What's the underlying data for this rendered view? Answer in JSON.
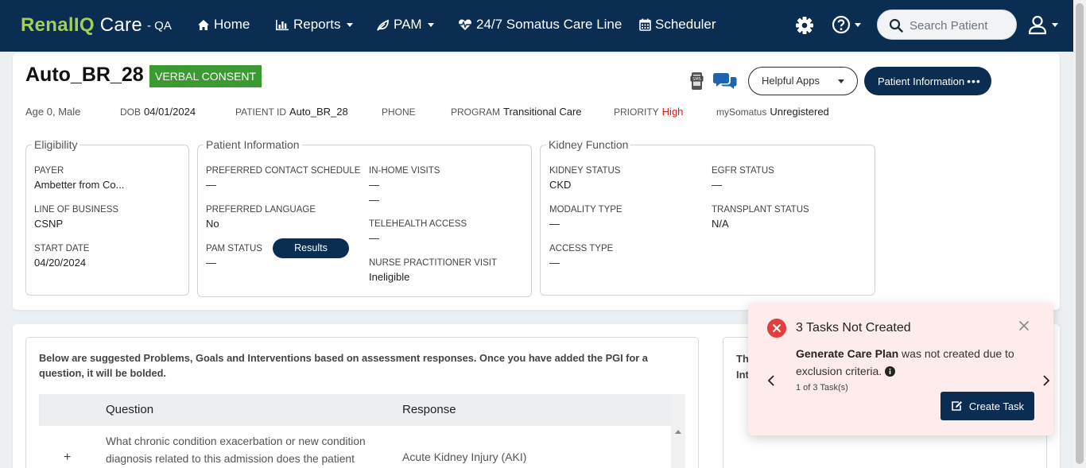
{
  "nav": {
    "logo_part1": "Renal",
    "logo_part2": "IQ",
    "logo_part3": " Care",
    "env": "- QA",
    "home": "Home",
    "reports": "Reports",
    "pam": "PAM",
    "care_line": "24/7 Somatus Care Line",
    "scheduler": "Scheduler",
    "search_placeholder": "Search Patient"
  },
  "patient": {
    "name": "Auto_BR_28",
    "consent": "VERBAL CONSENT",
    "helpful_apps": "Helpful Apps",
    "patient_info_btn": "Patient Information",
    "age_sex": "Age 0, Male",
    "dob_label": "DOB",
    "dob": "04/01/2024",
    "id_label": "PATIENT ID",
    "id": "Auto_BR_28",
    "phone_label": "PHONE",
    "phone": "",
    "program_label": "PROGRAM",
    "program": "Transitional Care",
    "priority_label": "PRIORITY",
    "priority": "High",
    "mysomatus_label": "mySomatus",
    "mysomatus": "Unregistered"
  },
  "eligibility": {
    "legend": "Eligibility",
    "payer_label": "PAYER",
    "payer": "Ambetter from Co...",
    "lob_label": "LINE OF BUSINESS",
    "lob": "CSNP",
    "start_label": "START DATE",
    "start": "04/20/2024"
  },
  "patient_information": {
    "legend": "Patient Information",
    "contact_label": "PREFERRED CONTACT SCHEDULE",
    "contact": "—",
    "language_label": "PREFERRED LANGUAGE",
    "language": "No",
    "pam_label": "PAM STATUS",
    "pam": "—",
    "results_btn": "Results",
    "inhome_label": "IN-HOME VISITS",
    "inhome1": "—",
    "inhome2": "—",
    "telehealth_label": "TELEHEALTH ACCESS",
    "telehealth": "—",
    "np_label": "NURSE PRACTITIONER VISIT",
    "np": "Ineligible"
  },
  "kidney": {
    "legend": "Kidney Function",
    "status_label": "KIDNEY STATUS",
    "status": "CKD",
    "egfr_label": "EGFR STATUS",
    "egfr": "—",
    "modality_label": "MODALITY TYPE",
    "modality": "—",
    "transplant_label": "TRANSPLANT STATUS",
    "transplant": "N/A",
    "access_label": "ACCESS TYPE",
    "access": "—"
  },
  "pgi": {
    "intro": "Below are suggested Problems, Goals and Interventions based on assessment responses. Once you have added the PGI for a question, it will be bolded.",
    "col_question": "Question",
    "col_response": "Response",
    "row_question": "What chronic condition exacerbation or new condition diagnosis related to this admission does the patient",
    "row_response": "Acute Kidney Injury (AKI)",
    "right_line1": "Th",
    "right_line2": "Int"
  },
  "toast": {
    "title": "3 Tasks Not Created",
    "bold": "Generate Care Plan",
    "message": " was not created due to exclusion criteria.",
    "counter": "1 of 3 Task(s)",
    "create_btn": "Create Task"
  }
}
